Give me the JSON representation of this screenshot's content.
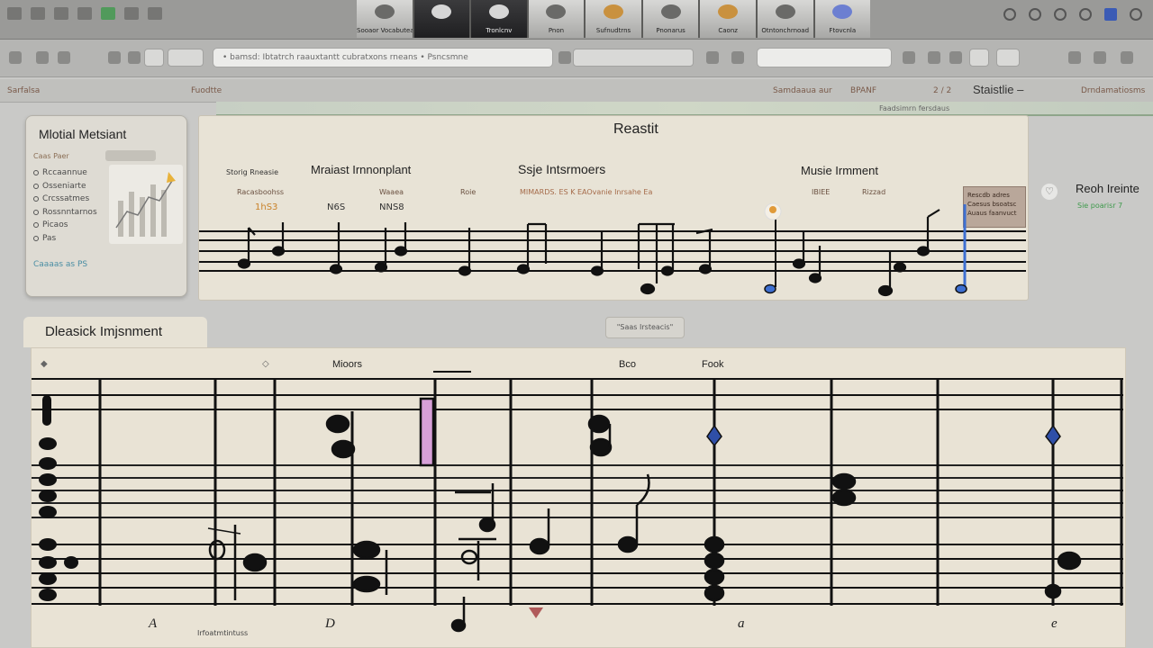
{
  "topbar": {
    "thumbnails": [
      {
        "label": "Sooaor Vocabuteato",
        "style": "plain"
      },
      {
        "label": "",
        "style": "dark"
      },
      {
        "label": "Tronlcnv",
        "style": "dark"
      },
      {
        "label": "Pnon",
        "style": "plain"
      },
      {
        "label": "Sufnudtrns",
        "style": "warm"
      },
      {
        "label": "Pnonarus",
        "style": "plain"
      },
      {
        "label": "Caonz",
        "style": "warm"
      },
      {
        "label": "Otntonchrnoad",
        "style": "plain"
      },
      {
        "label": "Ftovcnla",
        "style": "blue"
      }
    ]
  },
  "toolbar": {
    "address": "• bamsd: Ibtatrch raauxtantt cubratxons rneans •  Psncsmne"
  },
  "infostrip": {
    "left": "Sarfalsa",
    "left2": "Fuodtte",
    "mid": "Samdaaua aur",
    "mid2": "BPANF",
    "ratio": "2 / 2",
    "status": "Staistlie –",
    "right": "Drndamatiosms"
  },
  "greenbar": {
    "text": "Faadsimrn fersdaus"
  },
  "assistant": {
    "title": "Mlotial Metsiant",
    "tab_hint": "Caas  Paer",
    "items": [
      "Rccaannue",
      "Osseniarte",
      "Crcssatmes",
      "Rossnntarnos",
      "Picaos",
      "Pas"
    ],
    "footer": "Caaaas as  PS"
  },
  "result": {
    "title": "Reastit",
    "labels": {
      "a": "Mraiast Irnnonplant",
      "b": "Ssje Intsrmoers",
      "c": "Musie Irmment",
      "small_left": "Storig Rneasie",
      "small_left2": "Racasboohss",
      "small_mid": "Waaea",
      "small_mid2": "Roie",
      "small_mid3": "MIMARDS. ES  K EAOvanie Inrsahe Ea",
      "small_r1": "IBIEE",
      "small_r2": "Rizzad"
    },
    "numbers": {
      "n1": "1hS3",
      "n2": "N6S",
      "n3": "NNS8"
    },
    "tooltip": "Rescdb adres Caesus bsoatsc Auaus faanvuct"
  },
  "right": {
    "label": "Reoh Ireinte",
    "sub": "Sie poarisr 7"
  },
  "section": {
    "title": "Dleasick Imjsnment",
    "mini_button": "\"Saas Irsteacis\""
  },
  "score": {
    "col_heads": [
      "Mioors",
      "Bco",
      "Fook"
    ],
    "marks": [
      "A",
      "D",
      "a",
      "e"
    ],
    "foot_small": "Irfoatmtintuss"
  }
}
